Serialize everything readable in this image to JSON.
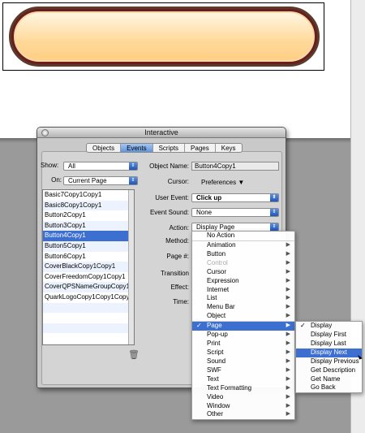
{
  "palette": {
    "title": "Interactive",
    "tabs": [
      "Objects",
      "Events",
      "Scripts",
      "Pages",
      "Keys"
    ],
    "active_tab": "Events"
  },
  "show": {
    "label": "Show:",
    "value": "All"
  },
  "on": {
    "label": "On:",
    "value": "Current Page"
  },
  "object_list": [
    "Basic7Copy1Copy1",
    "Basic8Copy1Copy1",
    "Button2Copy1",
    "Button3Copy1",
    "Button4Copy1",
    "Button5Copy1",
    "Button6Copy1",
    "CoverBlackCopy1Copy1",
    "CoverFreedomCopy1Copy1",
    "CoverQPSNameGroupCopy1...",
    "QuarkLogoCopy1Copy1Copy"
  ],
  "selected_object": "Button4Copy1",
  "fields": {
    "object_name_label": "Object Name:",
    "object_name_value": "Button4Copy1",
    "cursor_label": "Cursor:",
    "cursor_value": "Preferences ▼",
    "user_event_label": "User Event:",
    "user_event_value": "Click up",
    "event_sound_label": "Event Sound:",
    "event_sound_value": "None",
    "action_label": "Action:",
    "action_value": "Display Page",
    "method_label": "Method:",
    "page_label": "Page #:",
    "transition_label": "Transition",
    "effect_label": "Effect:",
    "time_label": "Time:"
  },
  "action_menu": [
    {
      "label": "No Action",
      "sub": false
    },
    {
      "label": "Animation",
      "sub": true
    },
    {
      "label": "Button",
      "sub": true
    },
    {
      "label": "Control",
      "sub": true,
      "disabled": true
    },
    {
      "label": "Cursor",
      "sub": true
    },
    {
      "label": "Expression",
      "sub": true
    },
    {
      "label": "Internet",
      "sub": true
    },
    {
      "label": "List",
      "sub": true
    },
    {
      "label": "Menu Bar",
      "sub": true
    },
    {
      "label": "Object",
      "sub": true
    },
    {
      "label": "Page",
      "sub": true,
      "checked": true,
      "highlight": true
    },
    {
      "label": "Pop-up",
      "sub": true
    },
    {
      "label": "Print",
      "sub": true
    },
    {
      "label": "Script",
      "sub": true
    },
    {
      "label": "Sound",
      "sub": true
    },
    {
      "label": "SWF",
      "sub": true
    },
    {
      "label": "Text",
      "sub": true
    },
    {
      "label": "Text Formatting",
      "sub": true
    },
    {
      "label": "Video",
      "sub": true
    },
    {
      "label": "Window",
      "sub": true
    },
    {
      "label": "Other",
      "sub": true
    }
  ],
  "page_submenu": [
    {
      "label": "Display",
      "checked": true
    },
    {
      "label": "Display First"
    },
    {
      "label": "Display Last"
    },
    {
      "label": "Display Next",
      "highlight": true
    },
    {
      "label": "Display Previous"
    },
    {
      "label": "Get Description"
    },
    {
      "label": "Get Name"
    },
    {
      "label": "Go Back"
    }
  ],
  "symbols": {
    "check": "✓",
    "submenu": "▶",
    "popup_arrows": "⇕",
    "trash": "🗑"
  },
  "colors": {
    "highlight": "#3d6fd1",
    "tab_active": "#5f95dd",
    "button_fill": "#ffd99a",
    "button_border": "#6b1d1d"
  }
}
